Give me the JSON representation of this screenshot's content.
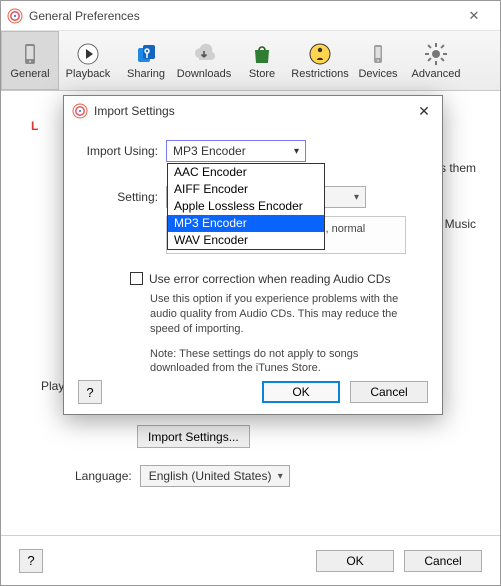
{
  "window": {
    "title": "General Preferences",
    "close_glyph": "✕"
  },
  "toolbar": {
    "tabs": [
      {
        "label": "General"
      },
      {
        "label": "Playback"
      },
      {
        "label": "Sharing"
      },
      {
        "label": "Downloads"
      },
      {
        "label": "Store"
      },
      {
        "label": "Restrictions"
      },
      {
        "label": "Devices"
      },
      {
        "label": "Advanced"
      }
    ]
  },
  "prefs": {
    "partial_left_1": "L",
    "partial_right_1": "s them",
    "partial_right_2": "e Music",
    "play_label_partial": "Play",
    "import_settings_button": "Import Settings...",
    "language_label": "Language:",
    "language_value": "English (United States)"
  },
  "bottom": {
    "help": "?",
    "ok": "OK",
    "cancel": "Cancel"
  },
  "dialog": {
    "title": "Import Settings",
    "close_glyph": "✕",
    "import_using_label": "Import Using:",
    "import_using_value": "MP3 Encoder",
    "options": [
      "AAC Encoder",
      "AIFF Encoder",
      "Apple Lossless Encoder",
      "MP3 Encoder",
      "WAV Encoder"
    ],
    "selected_index": 3,
    "setting_label": "Setting:",
    "details_partial": "), normal stereo.",
    "error_correction_label": "Use error correction when reading Audio CDs",
    "error_help": "Use this option if you experience problems with the audio quality from Audio CDs.  This may reduce the speed of importing.",
    "note": "Note: These settings do not apply to songs downloaded from the iTunes Store.",
    "help": "?",
    "ok": "OK",
    "cancel": "Cancel"
  }
}
